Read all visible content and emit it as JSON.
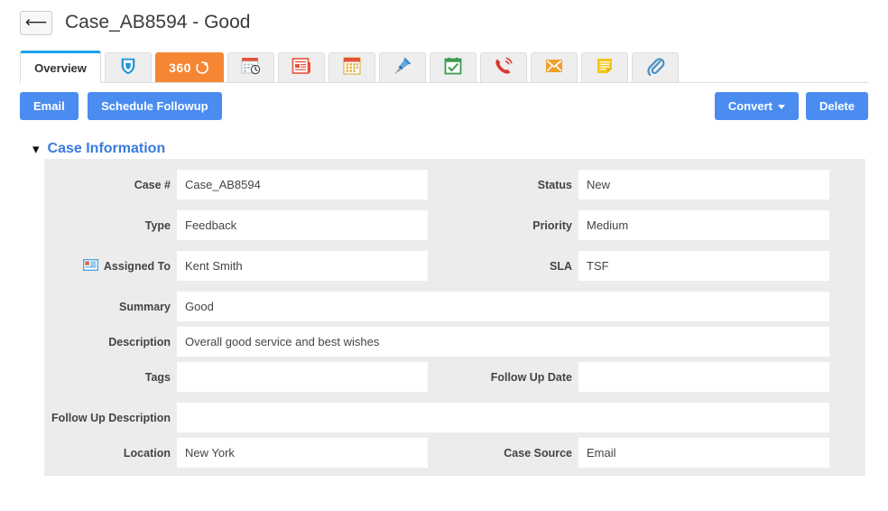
{
  "header": {
    "back_icon": "back-arrow-icon",
    "title": "Case_AB8594 - Good"
  },
  "tabs": [
    {
      "label": "Overview",
      "type": "text",
      "active": true,
      "icon": null
    },
    {
      "label": "",
      "type": "icon",
      "active": false,
      "icon": "shield-blue-icon"
    },
    {
      "label": "360",
      "type": "icon-text",
      "active": false,
      "icon": "refresh-360-icon"
    },
    {
      "label": "",
      "type": "icon",
      "active": false,
      "icon": "calendar-clock-icon"
    },
    {
      "label": "",
      "type": "icon",
      "active": false,
      "icon": "news-article-icon"
    },
    {
      "label": "",
      "type": "icon",
      "active": false,
      "icon": "calendar-grid-icon"
    },
    {
      "label": "",
      "type": "icon",
      "active": false,
      "icon": "pushpin-icon"
    },
    {
      "label": "",
      "type": "icon",
      "active": false,
      "icon": "task-check-icon"
    },
    {
      "label": "",
      "type": "icon",
      "active": false,
      "icon": "phone-call-icon"
    },
    {
      "label": "",
      "type": "icon",
      "active": false,
      "icon": "envelope-icon"
    },
    {
      "label": "",
      "type": "icon",
      "active": false,
      "icon": "note-icon"
    },
    {
      "label": "",
      "type": "icon",
      "active": false,
      "icon": "paperclip-icon"
    }
  ],
  "toolbar": {
    "email_label": "Email",
    "schedule_followup_label": "Schedule Followup",
    "convert_label": "Convert",
    "delete_label": "Delete"
  },
  "section": {
    "collapse_icon": "chevron-down-icon",
    "title": "Case Information"
  },
  "form": {
    "case_number": {
      "label": "Case #",
      "value": "Case_AB8594",
      "placeholder": ""
    },
    "status": {
      "label": "Status",
      "value": "New",
      "placeholder": ""
    },
    "type": {
      "label": "Type",
      "value": "Feedback",
      "placeholder": ""
    },
    "priority": {
      "label": "Priority",
      "value": "Medium",
      "placeholder": ""
    },
    "assigned_to": {
      "label": "Assigned To",
      "value": "Kent Smith",
      "placeholder": "",
      "icon": "vcard-icon"
    },
    "sla": {
      "label": "SLA",
      "value": "TSF",
      "placeholder": ""
    },
    "summary": {
      "label": "Summary",
      "value": "Good",
      "placeholder": ""
    },
    "description": {
      "label": "Description",
      "value": "Overall good service and best wishes",
      "placeholder": ""
    },
    "tags": {
      "label": "Tags",
      "value": "",
      "placeholder": ""
    },
    "follow_up_date": {
      "label": "Follow Up Date",
      "value": "",
      "placeholder": ""
    },
    "follow_up_description": {
      "label": "Follow Up Description",
      "value": "",
      "placeholder": ""
    },
    "location": {
      "label": "Location",
      "value": "New York",
      "placeholder": ""
    },
    "case_source": {
      "label": "Case Source",
      "value": "Email",
      "placeholder": ""
    }
  },
  "colors": {
    "accent_blue": "#4a8cf0",
    "tab_active_blue": "#1aa3e8",
    "tab_orange": "#f58634",
    "section_link": "#3a7ae0",
    "panel_bg": "#ececec"
  }
}
